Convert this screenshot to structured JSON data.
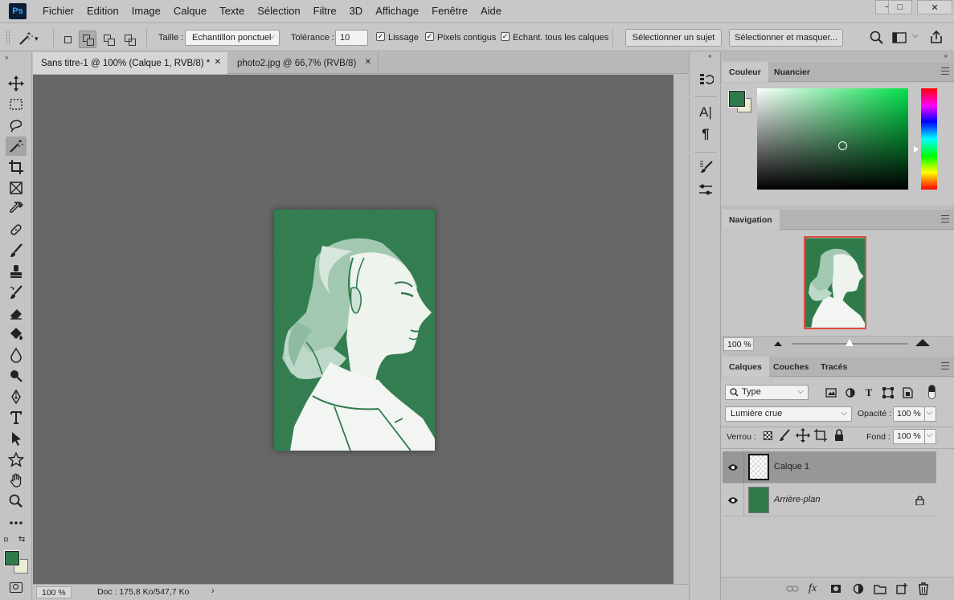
{
  "app": {
    "logo": "Ps"
  },
  "menu": [
    "Fichier",
    "Edition",
    "Image",
    "Calque",
    "Texte",
    "Sélection",
    "Filtre",
    "3D",
    "Affichage",
    "Fenêtre",
    "Aide"
  ],
  "window_controls": {
    "minimize": "−",
    "maximize": "□",
    "close": "✕"
  },
  "options": {
    "size_label": "Taille :",
    "size_value": "Echantillon ponctuel",
    "tolerance_label": "Tolérance :",
    "tolerance_value": "10",
    "antialias_label": "Lissage",
    "contiguous_label": "Pixels contigus",
    "sample_all_label": "Echant. tous les calques",
    "select_subject": "Sélectionner un sujet",
    "select_mask": "Sélectionner et masquer..."
  },
  "tabs": [
    {
      "label": "Sans titre-1 @ 100% (Calque 1, RVB/8) *",
      "active": true
    },
    {
      "label": "photo2.jpg @ 66,7% (RVB/8)",
      "active": false
    }
  ],
  "status": {
    "zoom": "100 %",
    "doc": "Doc : 175,8 Ko/547,7 Ko"
  },
  "colors": {
    "foreground": "#2e7a4d",
    "background": "#ecebd4",
    "picker_hue": "#00e04a"
  },
  "color_panel": {
    "tabs": [
      "Couleur",
      "Nuancier"
    ]
  },
  "navigator": {
    "tab": "Navigation",
    "zoom": "100 %"
  },
  "layers_panel": {
    "tabs": [
      "Calques",
      "Couches",
      "Tracés"
    ],
    "filter_value": "Type",
    "blend_mode": "Lumière crue",
    "opacity_label": "Opacité :",
    "opacity_value": "100 %",
    "lock_label": "Verrou :",
    "fill_label": "Fond :",
    "fill_value": "100 %",
    "layers": [
      {
        "name": "Calque 1",
        "selected": true
      },
      {
        "name": "Arrière-plan",
        "selected": false,
        "locked": true
      }
    ],
    "footer_icons": [
      "link-icon",
      "fx-icon",
      "mask-icon",
      "adjustment-icon",
      "folder-icon",
      "new-layer-icon",
      "trash-icon"
    ]
  },
  "tools": [
    "move-icon",
    "marquee-icon",
    "lasso-icon",
    "magic-wand-icon",
    "crop-icon",
    "frame-icon",
    "eyedropper-icon",
    "healing-icon",
    "brush-icon",
    "stamp-icon",
    "history-brush-icon",
    "eraser-icon",
    "paint-bucket-icon",
    "blur-icon",
    "dodge-icon",
    "pen-icon",
    "type-icon",
    "path-select-icon",
    "shape-icon",
    "hand-icon",
    "zoom-icon",
    "more-icon"
  ]
}
